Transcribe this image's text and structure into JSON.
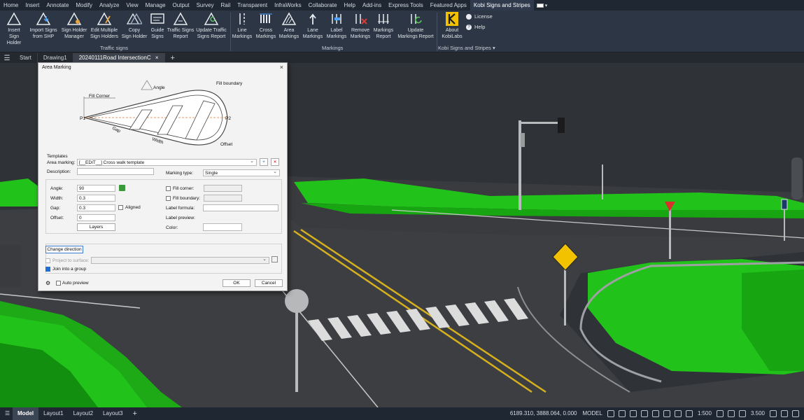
{
  "menu": [
    "Home",
    "Insert",
    "Annotate",
    "Modify",
    "Analyze",
    "View",
    "Manage",
    "Output",
    "Survey",
    "Rail",
    "Transparent",
    "InfraWorks",
    "Collaborate",
    "Help",
    "Add-ins",
    "Express Tools",
    "Featured Apps",
    "Kobi Signs and Stripes"
  ],
  "ribbon": {
    "traffic_buttons": [
      {
        "label1": "Insert",
        "label2": "Sign Holder"
      },
      {
        "label1": "Import Signs",
        "label2": "from SHP"
      },
      {
        "label1": "Sign Holder",
        "label2": "Manager"
      },
      {
        "label1": "Edit Multiple",
        "label2": "Sign Holders"
      },
      {
        "label1": "Copy",
        "label2": "Sign Holder"
      },
      {
        "label1": "Guide",
        "label2": "Signs"
      },
      {
        "label1": "Traffic Signs",
        "label2": "Report"
      },
      {
        "label1": "Update Traffic",
        "label2": "Signs Report"
      }
    ],
    "traffic_group": "Traffic signs",
    "marking_buttons": [
      {
        "label1": "Line",
        "label2": "Markings"
      },
      {
        "label1": "Cross",
        "label2": "Markings"
      },
      {
        "label1": "Area",
        "label2": "Markings"
      },
      {
        "label1": "Lane",
        "label2": "Markings"
      },
      {
        "label1": "Label",
        "label2": "Markings"
      },
      {
        "label1": "Remove",
        "label2": "Markings"
      },
      {
        "label1": "Markings",
        "label2": "Report"
      },
      {
        "label1": "Update",
        "label2": "Markings Report"
      }
    ],
    "markings_group": "Markings",
    "about": {
      "label1": "About",
      "label2": "KobiLabs"
    },
    "license": "License",
    "help": "Help",
    "kobi_group": "Kobi Signs and Stripes"
  },
  "doctabs": [
    "Start",
    "Drawing1",
    "20240111Road IntersectionC"
  ],
  "dialog": {
    "title": "Area Marking",
    "diagram": {
      "angle": "Angle",
      "fill_boundary": "Fill boundary",
      "fill_corner": "Fill Corner",
      "p1": "P1",
      "p2": "P2",
      "gap": "Gap",
      "width": "Width",
      "offset": "Offset"
    },
    "templates_label": "Templates",
    "area_marking_label": "Area marking:",
    "area_marking_value": "[__EDIT__] Cross walk template",
    "description_label": "Description:",
    "description_value": "",
    "marking_type_label": "Marking type:",
    "marking_type_value": "Single",
    "angle_label": "Angle:",
    "angle_value": "90",
    "width_label": "Width:",
    "width_value": "0.3",
    "gap_label": "Gap:",
    "gap_value": "0.3",
    "aligned_label": "Aligned",
    "offset_label": "Offset:",
    "offset_value": "0",
    "layers_button": "Layers",
    "fill_corner_label": "Fill corner:",
    "fill_boundary_label": "Fill boundary:",
    "label_formula_label": "Label formula:",
    "label_preview_label": "Label preview:",
    "color_label": "Color:",
    "change_direction": "Change direction",
    "project_label": "Project to surface:",
    "join_label": "Join into a group",
    "auto_preview": "Auto preview",
    "ok": "OK",
    "cancel": "Cancel"
  },
  "status": {
    "tabs": [
      "Model",
      "Layout1",
      "Layout2",
      "Layout3"
    ],
    "coords": "6189.310, 3888.064, 0.000",
    "mode": "MODEL",
    "scale": "1:500",
    "lineweight": "3.500"
  },
  "colors": {
    "terrain_green": "#21c21a",
    "road_gray": "#3d3e41",
    "ribbon_bg": "#2c3644",
    "accent_yellow": "#f2c200"
  }
}
